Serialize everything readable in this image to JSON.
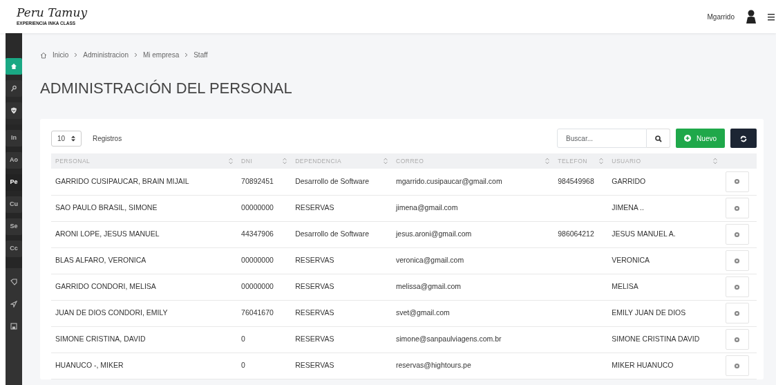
{
  "header": {
    "logo_title": "Peru Tamuy",
    "logo_subtitle": "EXPERIENCIA INKA CLASS",
    "user_name": "Mgarrido"
  },
  "sidebar": {
    "top_items": [
      {
        "kind": "home",
        "selected": true
      },
      {
        "kind": "key",
        "selected": false
      },
      {
        "kind": "shield",
        "selected": false
      }
    ],
    "text_items": [
      {
        "label": "In",
        "selected": false
      },
      {
        "label": "Ao",
        "selected": false
      },
      {
        "label": "Pe",
        "selected": true
      },
      {
        "label": "Cu",
        "selected": false
      },
      {
        "label": "Se",
        "selected": false
      },
      {
        "label": "Cc",
        "selected": false
      }
    ],
    "bottom_items": [
      {
        "kind": "tag"
      },
      {
        "kind": "send"
      },
      {
        "kind": "save"
      }
    ]
  },
  "breadcrumb": [
    "Inicio",
    "Administracion",
    "Mi empresa",
    "Staff"
  ],
  "page_title": "ADMINISTRACIÓN DEL PERSONAL",
  "toolbar": {
    "page_size": "10",
    "page_size_label": "Registros",
    "search": {
      "placeholder": "Buscar..."
    },
    "new_button": "Nuevo"
  },
  "table": {
    "columns": [
      "PERSONAL",
      "DNI",
      "DEPENDENCIA",
      "CORREO",
      "TELEFON",
      "USUARIO"
    ],
    "rows": [
      [
        "GARRIDO CUSIPAUCAR, BRAIN MIJAIL",
        "70892451",
        "Desarrollo de Software",
        "mgarrido.cusipaucar@gmail.com",
        "984549968",
        "GARRIDO"
      ],
      [
        "SAO PAULO BRASIL, SIMONE",
        "00000000",
        "RESERVAS",
        "jimena@gmail.com",
        "",
        "JIMENA .."
      ],
      [
        "ARONI LOPE, JESUS MANUEL",
        "44347906",
        "Desarrollo de Software",
        "jesus.aroni@gmail.com",
        "986064212",
        "JESUS MANUEL A."
      ],
      [
        "BLAS ALFARO, VERONICA",
        "00000000",
        "RESERVAS",
        "veronica@gmail.com",
        "",
        "VERONICA"
      ],
      [
        "GARRIDO CONDORI, MELISA",
        "00000000",
        "RESERVAS",
        "melissa@gmail.com",
        "",
        "MELISA"
      ],
      [
        "JUAN DE DIOS CONDORI, EMILY",
        "76041670",
        "RESERVAS",
        "svet@gmail.com",
        "",
        "EMILY JUAN DE DIOS"
      ],
      [
        "SIMONE CRISTINA, DAVID",
        "0",
        "RESERVAS",
        "simone@sanpaulviagens.com.br",
        "",
        "SIMONE CRISTINA DAVID"
      ],
      [
        "HUANUCO -, MIKER",
        "0",
        "RESERVAS",
        "reservas@hightours.pe",
        "",
        "MIKER HUANUCO"
      ]
    ]
  }
}
